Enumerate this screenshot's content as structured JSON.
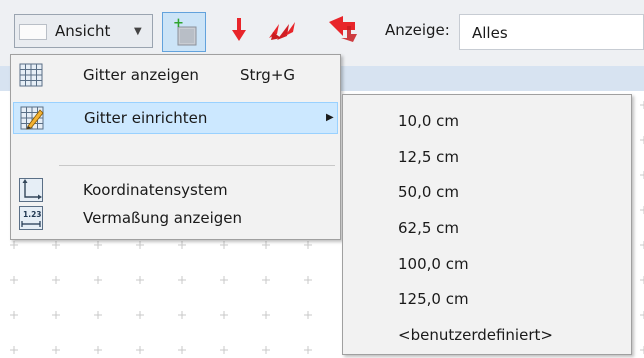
{
  "toolbar": {
    "view_label": "Ansicht",
    "display_label": "Anzeige:",
    "display_value": "Alles"
  },
  "menu": {
    "items": [
      {
        "label": "Gitter anzeigen",
        "shortcut": "Strg+G",
        "icon": "grid-icon"
      },
      {
        "label": "Gitter einrichten",
        "icon": "grid-edit-icon"
      },
      {
        "label": "Koordinatensystem",
        "icon": "coordinate-system-icon"
      },
      {
        "label": "Vermaßung anzeigen",
        "icon": "dimension-icon",
        "icon_text": "1.23"
      }
    ]
  },
  "submenu": {
    "items": [
      "10,0 cm",
      "12,5 cm",
      "50,0 cm",
      "62,5 cm",
      "100,0 cm",
      "125,0 cm",
      "<benutzerdefiniert>"
    ]
  },
  "colors": {
    "highlight": "#cce8ff",
    "toolbar_bg": "#eef0f3",
    "arrow_red": "#e8252a"
  }
}
